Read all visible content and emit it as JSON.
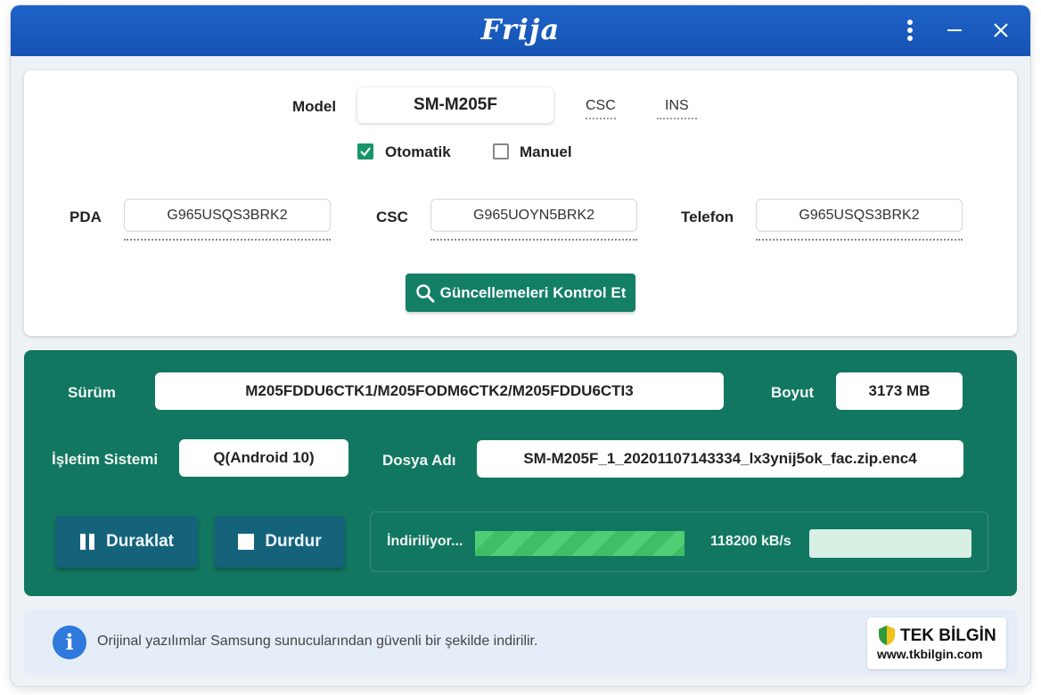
{
  "window": {
    "title": "Frija"
  },
  "model": {
    "label": "Model",
    "value": "SM-M205F",
    "csc_tab": "CSC",
    "ins_tab": "INS"
  },
  "mode": {
    "auto_label": "Otomatik",
    "auto_checked": true,
    "manual_label": "Manuel",
    "manual_checked": false
  },
  "firmware": {
    "pda_label": "PDA",
    "pda_value": "G965USQS3BRK2",
    "csc_label": "CSC",
    "csc_value": "G965UOYN5BRK2",
    "phone_label": "Telefon",
    "phone_value": "G965USQS3BRK2"
  },
  "check_button": {
    "label": "Güncellemeleri Kontrol Et",
    "icon": "search-icon"
  },
  "download": {
    "version_label": "Sürüm",
    "version_value": "M205FDDU6CTK1/M205FODM6CTK2/M205FDDU6CTI3",
    "size_label": "Boyut",
    "size_value": "3173 MB",
    "os_label": "İşletim Sistemi",
    "os_value": "Q(Android 10)",
    "file_label": "Dosya Adı",
    "file_value": "SM-M205F_1_20201107143334_lx3ynij5ok_fac.zip.enc4",
    "pause_label": "Duraklat",
    "stop_label": "Durdur",
    "status_text": "İndiriliyor...",
    "speed_text": "118200 kB/s"
  },
  "info": {
    "text": "Orijinal yazılımlar Samsung sunucularından güvenli bir şekilde indirilir.",
    "icon": "info-icon"
  },
  "watermark": {
    "title": "TEK BİLGİN",
    "url": "www.tkbilgin.com"
  },
  "colors": {
    "titlebar": "#1553b3",
    "panel": "#127760",
    "accent": "#17956a",
    "progress": "#4fce75"
  }
}
